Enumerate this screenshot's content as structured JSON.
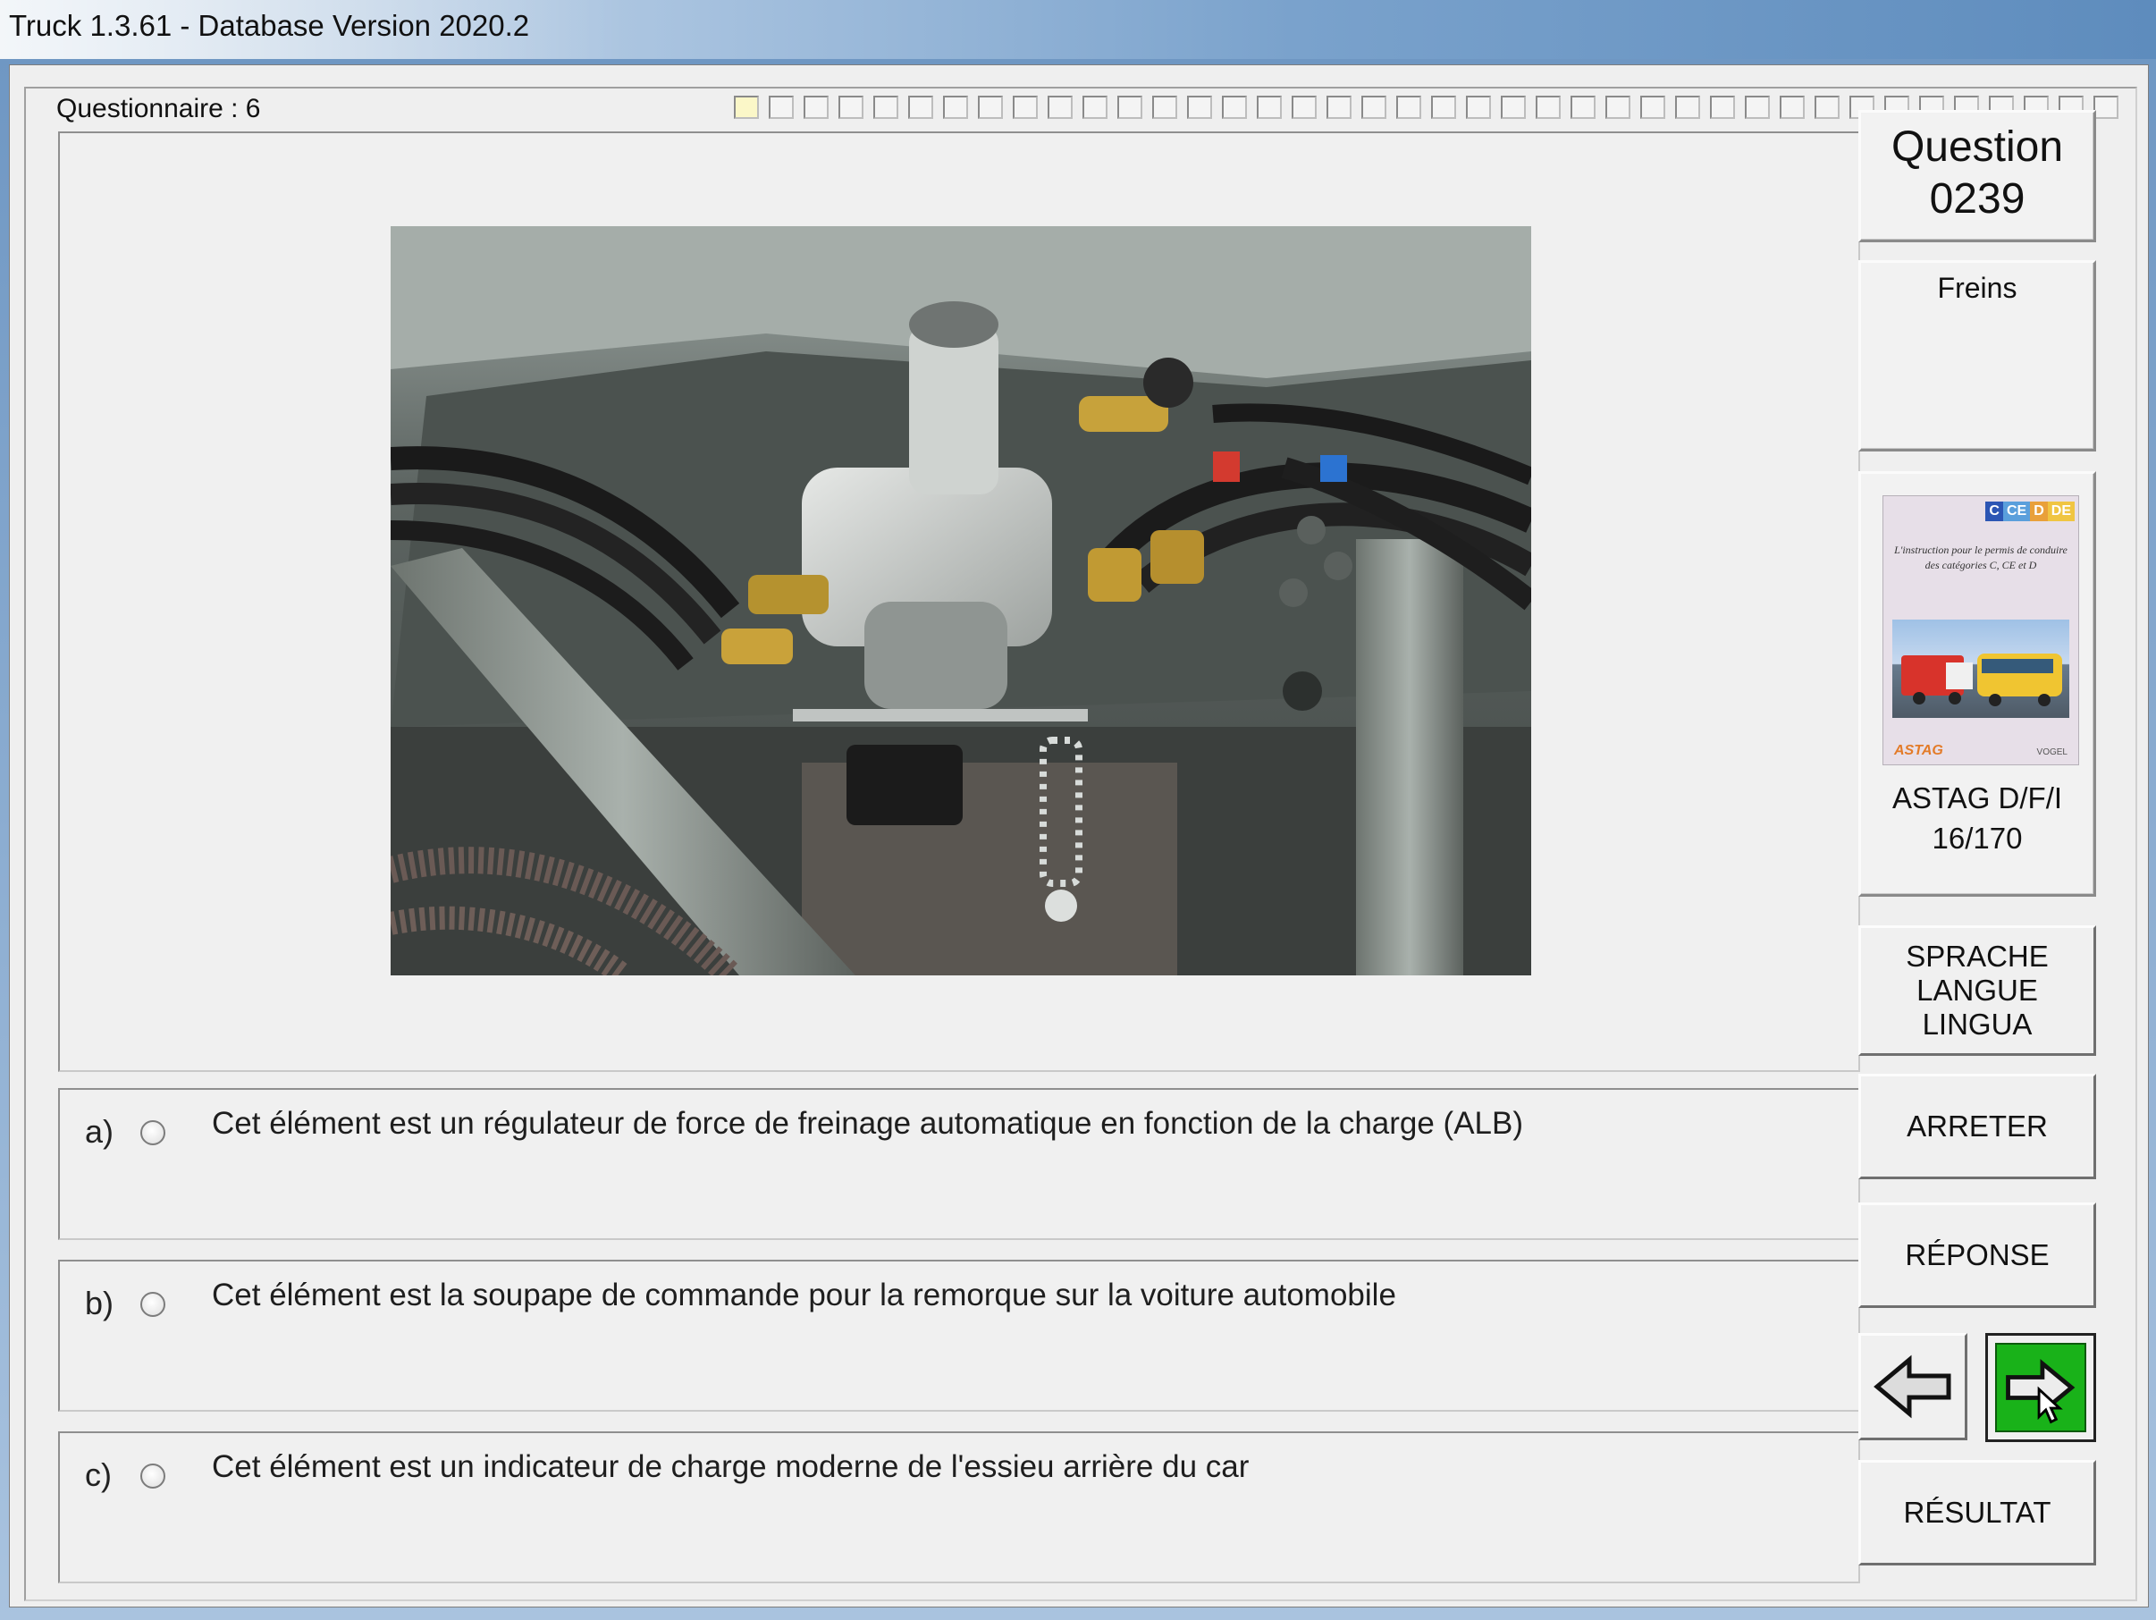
{
  "window": {
    "title": "Truck 1.3.61 - Database Version 2020.2"
  },
  "questionnaire": {
    "label": "Questionnaire : 6",
    "progress": {
      "total": 40,
      "completed": 1
    }
  },
  "question": {
    "label_line1": "Question",
    "number": "0239",
    "category": "Freins",
    "image_icon": "brake-valve-photo-icon"
  },
  "answers": [
    {
      "letter": "a)",
      "text": "Cet élément est un régulateur de force de freinage automatique en fonction de la charge (ALB)"
    },
    {
      "letter": "b)",
      "text": "Cet élément est la soupape de commande pour la remorque sur la voiture automobile"
    },
    {
      "letter": "c)",
      "text": "Cet élément est un indicateur de charge moderne de l'essieu arrière du car"
    }
  ],
  "source": {
    "book_tags": [
      "C",
      "CE",
      "D",
      "DE"
    ],
    "book_tag_colors": [
      "#2c56b4",
      "#5a9fdc",
      "#e9a03a",
      "#f0c542"
    ],
    "book_text": "L'instruction pour le permis de conduire des catégories C, CE et D",
    "book_logo_left": "ASTAG",
    "book_logo_right": "VOGEL",
    "line1": "ASTAG D/F/I",
    "line2": "16/170"
  },
  "buttons": {
    "lang_line1": "SPRACHE",
    "lang_line2": "LANGUE",
    "lang_line3": "LINGUA",
    "stop": "ARRETER",
    "response": "RÉPONSE",
    "result": "RÉSULTAT",
    "back_icon": "arrow-left-icon",
    "next_icon": "arrow-right-icon"
  },
  "colors": {
    "next_button": "#19b219"
  }
}
